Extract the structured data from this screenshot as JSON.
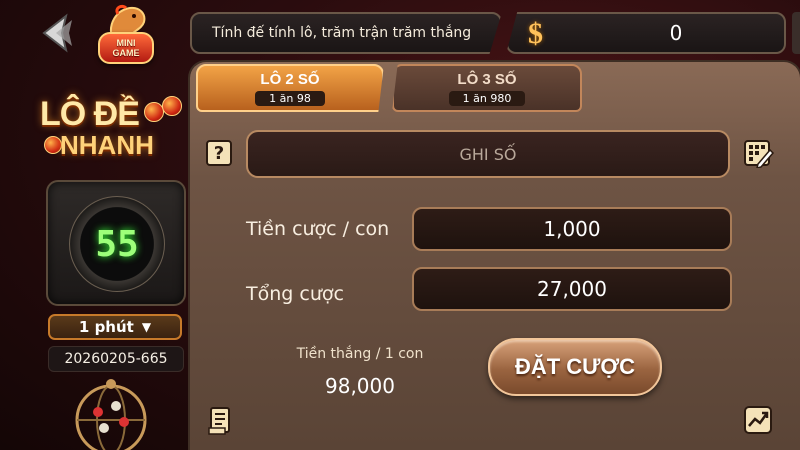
{
  "header": {
    "marquee_text": "Tính đế tính lô, trăm trận trăm thắng",
    "balance": {
      "currency_symbol": "$",
      "amount": "0"
    }
  },
  "brand": {
    "mini_game_badge": "MINI\nGAME",
    "game_logo_line1": "LÔ ĐỀ",
    "game_logo_line2": "NHANH"
  },
  "timer": {
    "seconds": "55"
  },
  "interval_select": {
    "selected": "1 phút",
    "caret": "▼"
  },
  "session": {
    "id": "20260205-665"
  },
  "tabs": [
    {
      "label": "LÔ 2 SỐ",
      "odds": "1 ăn 98",
      "active": true
    },
    {
      "label": "LÔ 3 SỐ",
      "odds": "1 ăn 980",
      "active": false
    }
  ],
  "number_input": {
    "placeholder": "GHI SỐ",
    "help_glyph": "?"
  },
  "bet_per_number": {
    "label": "Tiền cược / con",
    "value": "1,000"
  },
  "total_bet": {
    "label": "Tổng cược",
    "value": "27,000"
  },
  "win_per_number": {
    "label": "Tiền thắng / 1 con",
    "value": "98,000"
  },
  "actions": {
    "place_bet_label": "ĐẶT CƯỢC"
  },
  "colors": {
    "accent_orange": "#f2a346",
    "timer_green": "#9dff7a",
    "coin_gold": "#ffc15a",
    "panel_brown": "#6e5444"
  },
  "icons": {
    "back": "back-arrow-icon",
    "help": "help-icon",
    "keypad": "keypad-edit-icon",
    "history": "history-list-icon",
    "chart": "chart-icon"
  }
}
